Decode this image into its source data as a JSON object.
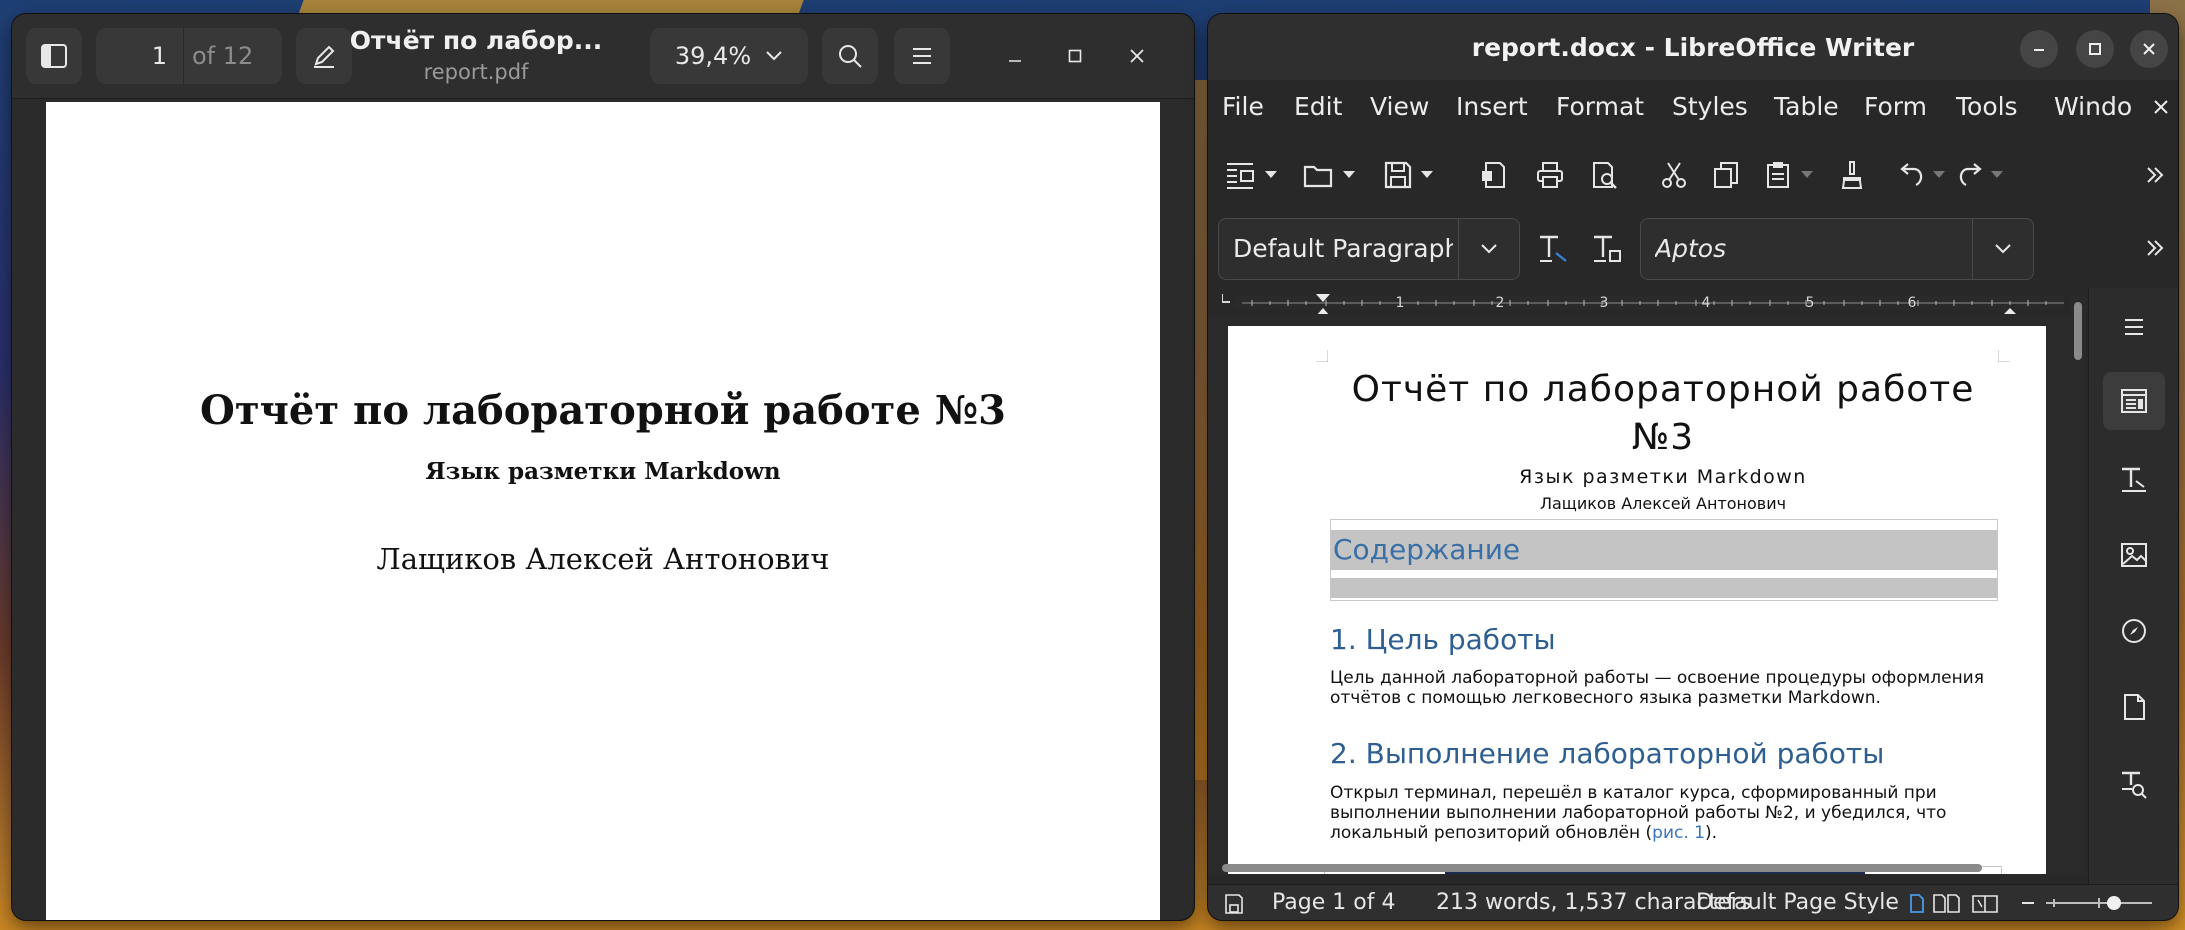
{
  "pdf_viewer": {
    "current_page": "1",
    "page_total": "of 12",
    "title": "Отчёт по лабор...",
    "filename": "report.pdf",
    "zoom": "39,4%",
    "page": {
      "title": "Отчёт по лабораторной работе №3",
      "subtitle": "Язык разметки Markdown",
      "author": "Лащиков Алексей Антонович"
    }
  },
  "writer": {
    "window_title": "report.docx - LibreOffice Writer",
    "menu": [
      "File",
      "Edit",
      "View",
      "Insert",
      "Format",
      "Styles",
      "Table",
      "Form",
      "Tools",
      "Windo"
    ],
    "paragraph_style": "Default Paragraph Styl",
    "font_name": "Aptos",
    "ruler_numbers": [
      "1",
      "2",
      "3",
      "4",
      "5",
      "6"
    ],
    "document": {
      "title_line1": "Отчёт по лабораторной работе",
      "title_line2": "№3",
      "subtitle": "Язык разметки Markdown",
      "author": "Лащиков Алексей Антонович",
      "toc_heading": "Содержание",
      "section1_heading": "1. Цель работы",
      "section1_line1": "Цель данной лабораторной работы — освоение процедуры оформления",
      "section1_line2": "отчётов с помощью легковесного языка разметки Markdown.",
      "section2_heading": "2. Выполнение лабораторной работы",
      "section2_line1": "Открыл терминал, перешёл в каталог курса, сформированный при",
      "section2_line2": "выполнении выполнении лабораторной работы №2, и убедился, что",
      "section2_line3_pre": "локальный репозиторий обновлён (",
      "section2_link": "рис. 1",
      "section2_line3_post": ")."
    },
    "status": {
      "page": "Page 1 of 4",
      "words": "213 words, 1,537 characters",
      "page_style": "Default Page Style"
    }
  }
}
